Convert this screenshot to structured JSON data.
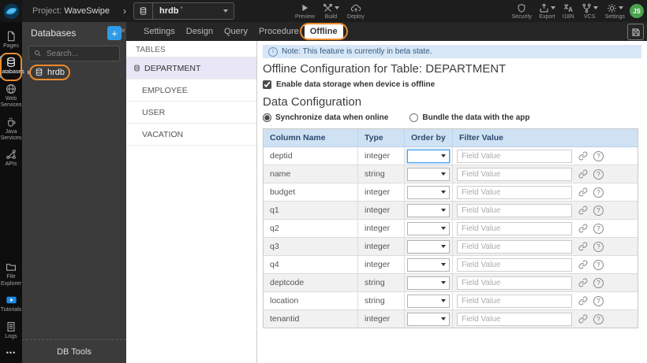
{
  "topbar": {
    "project_prefix": "Project:",
    "project_name": "WaveSwipe",
    "db_selector": {
      "value": "hrdb",
      "modified_marker": "*"
    },
    "actions": [
      {
        "label": "Preview"
      },
      {
        "label": "Build"
      },
      {
        "label": "Deploy"
      }
    ],
    "utilities": [
      {
        "label": "Security"
      },
      {
        "label": "Export"
      },
      {
        "label": "I18N"
      },
      {
        "label": "VCS"
      },
      {
        "label": "Settings"
      }
    ],
    "avatar_initials": "JS"
  },
  "sidebar": {
    "top_items": [
      {
        "label": "Pages",
        "active": false
      },
      {
        "label": "Databases",
        "active": true
      },
      {
        "label": "Web Services",
        "active": false
      },
      {
        "label": "Java Services",
        "active": false
      },
      {
        "label": "APIs",
        "active": false
      }
    ],
    "bottom_items": [
      {
        "label": "File Explorer"
      },
      {
        "label": "Tutorials"
      },
      {
        "label": "Logs"
      }
    ],
    "more_glyph": "•••"
  },
  "db_panel": {
    "title": "Databases",
    "add_label": "+",
    "collapse_glyph": "«",
    "search_placeholder": "Search...",
    "items": [
      {
        "label": "hrdb"
      }
    ],
    "footer": "DB Tools"
  },
  "tabs": {
    "items": [
      {
        "label": "Settings",
        "active": false
      },
      {
        "label": "Design",
        "active": false
      },
      {
        "label": "Query",
        "active": false
      },
      {
        "label": "Procedure",
        "active": false
      },
      {
        "label": "Offline",
        "active": true
      }
    ]
  },
  "tables_panel": {
    "title": "TABLES",
    "items": [
      {
        "label": "DEPARTMENT",
        "selected": true
      },
      {
        "label": "EMPLOYEE",
        "selected": false
      },
      {
        "label": "USER",
        "selected": false
      },
      {
        "label": "VACATION",
        "selected": false
      }
    ]
  },
  "content": {
    "note": "Note: This feature is currently in beta state.",
    "note_icon_glyph": "i",
    "title": "Offline Configuration for Table: DEPARTMENT",
    "enable_offline_label": "Enable data storage when device is offline",
    "enable_offline_checked": true,
    "section_title": "Data Configuration",
    "radio_options": [
      {
        "label": "Synchronize data when online",
        "selected": true
      },
      {
        "label": "Bundle the data with the app",
        "selected": false
      }
    ],
    "table": {
      "headers": [
        "Column Name",
        "Type",
        "Order by",
        "Filter Value"
      ],
      "filter_placeholder": "Field Value",
      "order_by_selected": "",
      "help_glyph": "?",
      "rows": [
        {
          "name": "deptid",
          "type": "integer"
        },
        {
          "name": "name",
          "type": "string"
        },
        {
          "name": "budget",
          "type": "integer"
        },
        {
          "name": "q1",
          "type": "integer"
        },
        {
          "name": "q2",
          "type": "integer"
        },
        {
          "name": "q3",
          "type": "integer"
        },
        {
          "name": "q4",
          "type": "integer"
        },
        {
          "name": "deptcode",
          "type": "string"
        },
        {
          "name": "location",
          "type": "string"
        },
        {
          "name": "tenantid",
          "type": "integer"
        }
      ]
    }
  },
  "colors": {
    "annotation_orange": "#ec8a2d",
    "accent_blue": "#2e9be6",
    "table_header_bg": "#cfe2f4",
    "note_bg": "#d7e7f7",
    "selected_row_bg": "#e9e6f7",
    "avatar_green": "#4aa34e",
    "tutorials_blue": "#1e88e5"
  }
}
